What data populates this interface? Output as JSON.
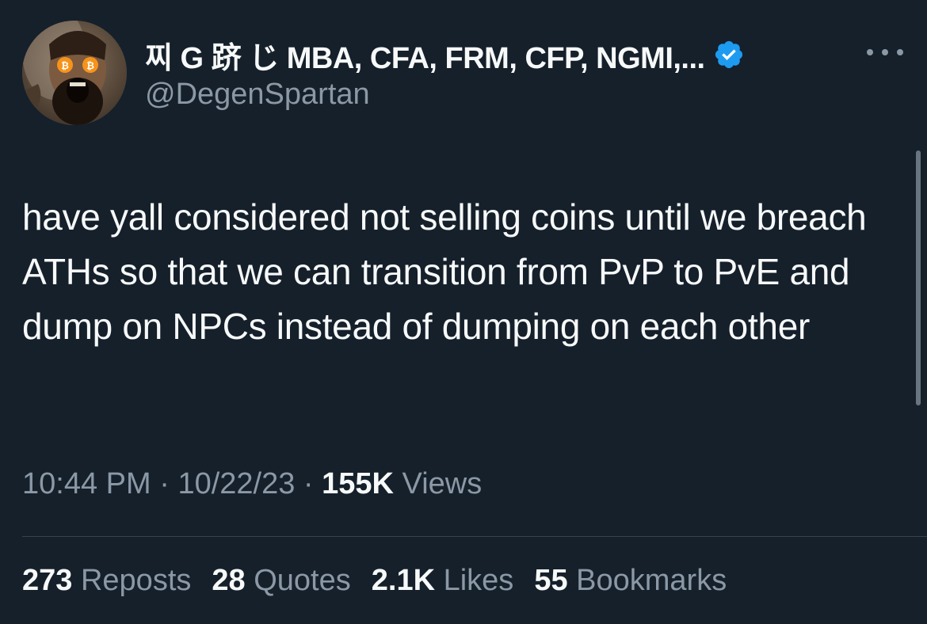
{
  "author": {
    "display_name": "찌 G 跻 じ MBA, CFA, FRM, CFP, NGMI,...",
    "handle": "@DegenSpartan",
    "avatar_icon": "spartan-avatar-icon",
    "verified_icon": "verified-badge-icon"
  },
  "tweet": {
    "text": "have yall considered not selling coins until we breach ATHs so that we can transition from PvP to PvE and dump on NPCs instead of dumping on each other",
    "time": "10:44 PM",
    "date": "10/22/23",
    "separator": "·",
    "views_count": "155K",
    "views_label": "Views"
  },
  "stats": [
    {
      "num": "273",
      "label": "Reposts"
    },
    {
      "num": "28",
      "label": "Quotes"
    },
    {
      "num": "2.1K",
      "label": "Likes"
    },
    {
      "num": "55",
      "label": "Bookmarks"
    }
  ],
  "colors": {
    "background": "#15202b",
    "text": "#f7f9f9",
    "secondary": "#8b98a5",
    "verified": "#1d9bf0",
    "divider": "#38444d"
  }
}
